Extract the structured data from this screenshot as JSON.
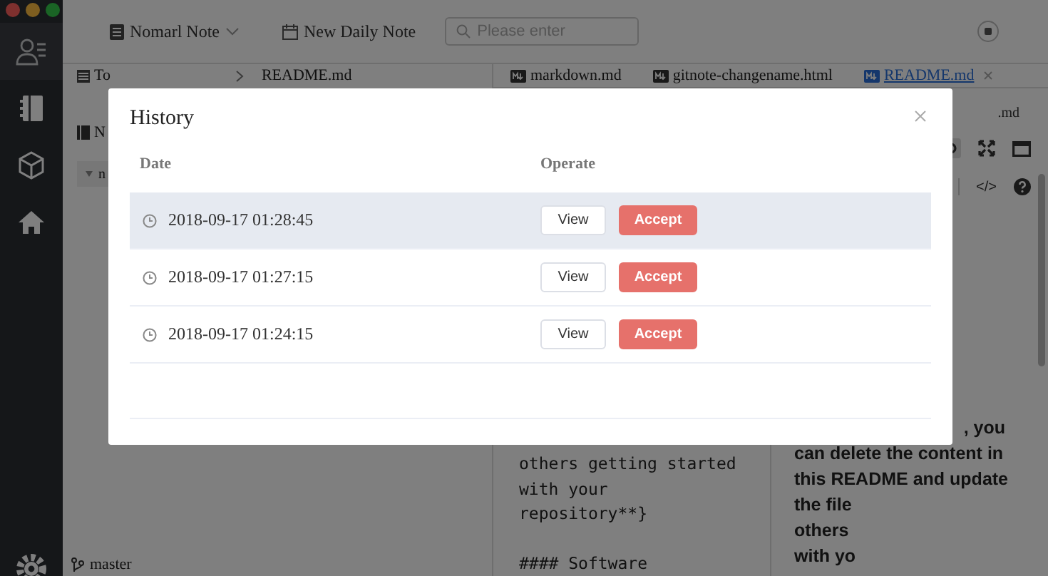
{
  "sidebar": {
    "items": [
      {
        "kind": "contacts"
      },
      {
        "kind": "notebook"
      },
      {
        "kind": "cube"
      },
      {
        "kind": "home"
      }
    ]
  },
  "toolbar": {
    "notebook_picker": "Nomarl Note",
    "new_note": "New Daily Note",
    "search": {
      "placeholder": "Please enter"
    }
  },
  "notes_panel": {
    "crumbs": [
      "To",
      "README.md"
    ],
    "tree": [
      {
        "label": "N",
        "children": [
          {
            "label": "n"
          }
        ]
      }
    ]
  },
  "file_tabs": [
    {
      "label": "markdown.md",
      "selected": false
    },
    {
      "label": "gitnote-changename.html",
      "selected": false
    },
    {
      "label": "README.md",
      "selected": true
    }
  ],
  "editor": {
    "paragraphs": [
      [
        "others getting started",
        "with your",
        "repository**}"
      ],
      [
        "#### Software"
      ]
    ]
  },
  "preview": {
    "file_label": ".md",
    "code_label": "</>",
    "lines": [
      ", you",
      "can delete the content in",
      "this README and update",
      "the file",
      "others",
      "with yo"
    ]
  },
  "status_bar": {
    "branch": "master"
  },
  "history_dialog": {
    "title": "History",
    "columns": [
      "Date",
      "Operate"
    ],
    "rows": [
      {
        "date": "2018-09-17 01:28:45",
        "highlighted": true,
        "actions": [
          {
            "label": "View",
            "kind": "plain"
          },
          {
            "label": "Accept",
            "kind": "danger"
          }
        ]
      },
      {
        "date": "2018-09-17 01:27:15",
        "highlighted": false,
        "actions": [
          {
            "label": "View",
            "kind": "plain"
          },
          {
            "label": "Accept",
            "kind": "danger"
          }
        ]
      },
      {
        "date": "2018-09-17 01:24:15",
        "highlighted": false,
        "actions": [
          {
            "label": "View",
            "kind": "plain"
          },
          {
            "label": "Accept",
            "kind": "danger"
          }
        ]
      }
    ]
  }
}
